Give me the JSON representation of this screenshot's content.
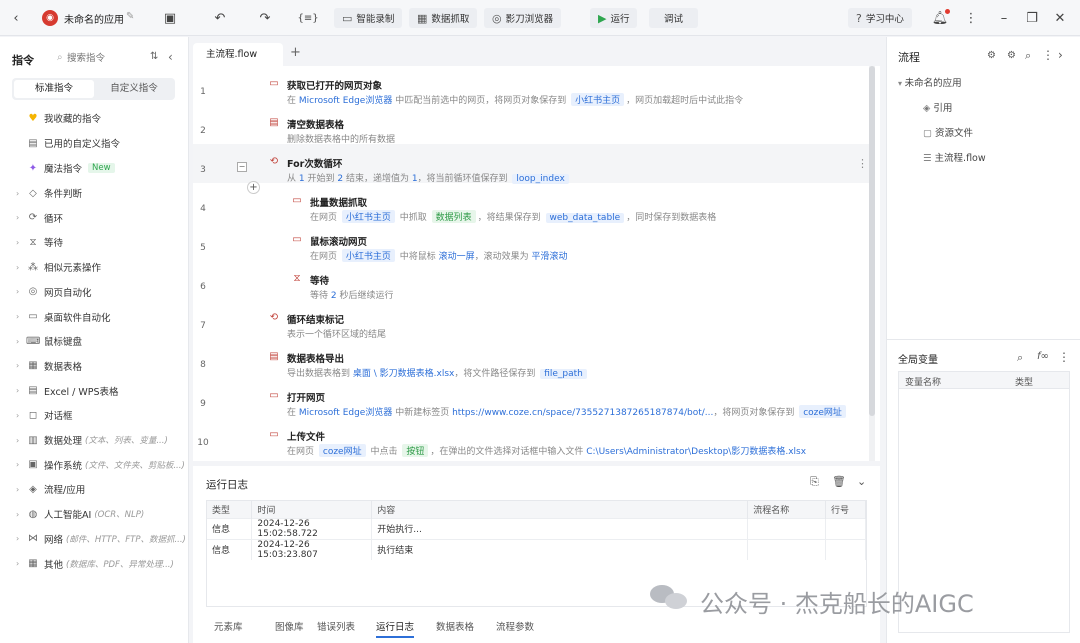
{
  "topbar": {
    "app_title": "未命名的应用",
    "btn_record": "智能录制",
    "btn_grab": "数据抓取",
    "btn_browser": "影刀浏览器",
    "btn_run": "运行",
    "btn_debug": "调试",
    "btn_learn": "学习中心"
  },
  "left": {
    "title": "指令",
    "search_placeholder": "搜索指令",
    "tab_standard": "标准指令",
    "tab_custom": "自定义指令",
    "fav": "我收藏的指令",
    "used_custom": "已用的自定义指令",
    "magic": "魔法指令",
    "magic_badge": "New",
    "groups": [
      {
        "label": "条件判断",
        "sub": ""
      },
      {
        "label": "循环",
        "sub": ""
      },
      {
        "label": "等待",
        "sub": ""
      },
      {
        "label": "相似元素操作",
        "sub": ""
      },
      {
        "label": "网页自动化",
        "sub": ""
      },
      {
        "label": "桌面软件自动化",
        "sub": ""
      },
      {
        "label": "鼠标键盘",
        "sub": ""
      },
      {
        "label": "数据表格",
        "sub": ""
      },
      {
        "label": "Excel / WPS表格",
        "sub": ""
      },
      {
        "label": "对话框",
        "sub": ""
      },
      {
        "label": "数据处理",
        "sub": "(文本、列表、变量...)"
      },
      {
        "label": "操作系统",
        "sub": "(文件、文件夹、剪贴板...)"
      },
      {
        "label": "流程/应用",
        "sub": ""
      },
      {
        "label": "人工智能AI",
        "sub": "(OCR、NLP)"
      },
      {
        "label": "网络",
        "sub": "(邮件、HTTP、FTP、数据抓...)"
      },
      {
        "label": "其他",
        "sub": "(数据库、PDF、异常处理...)"
      }
    ]
  },
  "editor": {
    "tab": "主流程.flow",
    "add_tab": "+",
    "steps": [
      {
        "line": "1",
        "title": "获取已打开的网页对象",
        "parts": [
          {
            "t": "在 "
          },
          {
            "b": "Microsoft Edge浏览器"
          },
          {
            "t": " 中匹配当前选中的网页，将网页对象保存到 "
          },
          {
            "tag": "小红书主页"
          },
          {
            "t": "，网页加载超时后中试此指令"
          }
        ]
      },
      {
        "line": "2",
        "title": "清空数据表格",
        "parts": [
          {
            "t": "删除数据表格中的所有数据"
          }
        ]
      },
      {
        "line": "3",
        "title": "For次数循环",
        "parts": [
          {
            "t": "从 "
          },
          {
            "b": "1"
          },
          {
            "t": " 开始到 "
          },
          {
            "b": "2"
          },
          {
            "t": " 结束，递增值为 "
          },
          {
            "b": "1"
          },
          {
            "t": "，将当前循环值保存到 "
          },
          {
            "tag": "loop_index"
          }
        ]
      },
      {
        "line": "4",
        "title": "批量数据抓取",
        "parts": [
          {
            "t": "在网页 "
          },
          {
            "tag": "小红书主页"
          },
          {
            "t": " 中抓取 "
          },
          {
            "tagg": "数据列表"
          },
          {
            "t": "，将结果保存到 "
          },
          {
            "tag": "web_data_table"
          },
          {
            "t": "，同时保存到数据表格"
          }
        ]
      },
      {
        "line": "5",
        "title": "鼠标滚动网页",
        "parts": [
          {
            "t": "在网页 "
          },
          {
            "tag": "小红书主页"
          },
          {
            "t": " 中将鼠标 "
          },
          {
            "b": "滚动一屏"
          },
          {
            "t": "，滚动效果为 "
          },
          {
            "b": "平滑滚动"
          }
        ]
      },
      {
        "line": "6",
        "title": "等待",
        "parts": [
          {
            "t": "等待 "
          },
          {
            "b": "2"
          },
          {
            "t": " 秒后继续运行"
          }
        ]
      },
      {
        "line": "7",
        "title": "循环结束标记",
        "parts": [
          {
            "t": "表示一个循环区域的结尾"
          }
        ]
      },
      {
        "line": "8",
        "title": "数据表格导出",
        "parts": [
          {
            "t": "导出数据表格到 "
          },
          {
            "b": "桌面 \\ 影刀数据表格.xlsx"
          },
          {
            "t": "，将文件路径保存到 "
          },
          {
            "tag": "file_path"
          }
        ]
      },
      {
        "line": "9",
        "title": "打开网页",
        "parts": [
          {
            "t": "在 "
          },
          {
            "b": "Microsoft Edge浏览器"
          },
          {
            "t": " 中新建标签页 "
          },
          {
            "b": "https://www.coze.cn/space/7355271387265187874/bot/..."
          },
          {
            "t": "，将网页对象保存到 "
          },
          {
            "tag": "coze网址"
          }
        ]
      },
      {
        "line": "10",
        "title": "上传文件",
        "parts": [
          {
            "t": "在网页 "
          },
          {
            "tag": "coze网址"
          },
          {
            "t": " 中点击 "
          },
          {
            "tagg": "按钮"
          },
          {
            "t": "，在弹出的文件选择对话框中输入文件 "
          },
          {
            "b": "C:\\Users\\Administrator\\Desktop\\影刀数据表格.xlsx"
          }
        ]
      }
    ]
  },
  "log": {
    "title": "运行日志",
    "headers": [
      "类型",
      "时间",
      "内容",
      "流程名称",
      "行号"
    ],
    "rows": [
      [
        "信息",
        "2024-12-26 15:02:58.722",
        "开始执行...",
        "",
        ""
      ],
      [
        "信息",
        "2024-12-26 15:03:23.807",
        "执行结束",
        "",
        ""
      ]
    ],
    "tabs": [
      "元素库",
      "图像库",
      "错误列表",
      "运行日志",
      "数据表格",
      "流程参数"
    ]
  },
  "right": {
    "title": "流程",
    "tree_root": "未命名的应用",
    "tree_items": [
      "引用",
      "资源文件",
      "主流程.flow"
    ],
    "vars_title": "全局变量",
    "vars_headers": [
      "变量名称",
      "类型"
    ]
  },
  "watermark": "公众号 · 杰克船长的AIGC"
}
